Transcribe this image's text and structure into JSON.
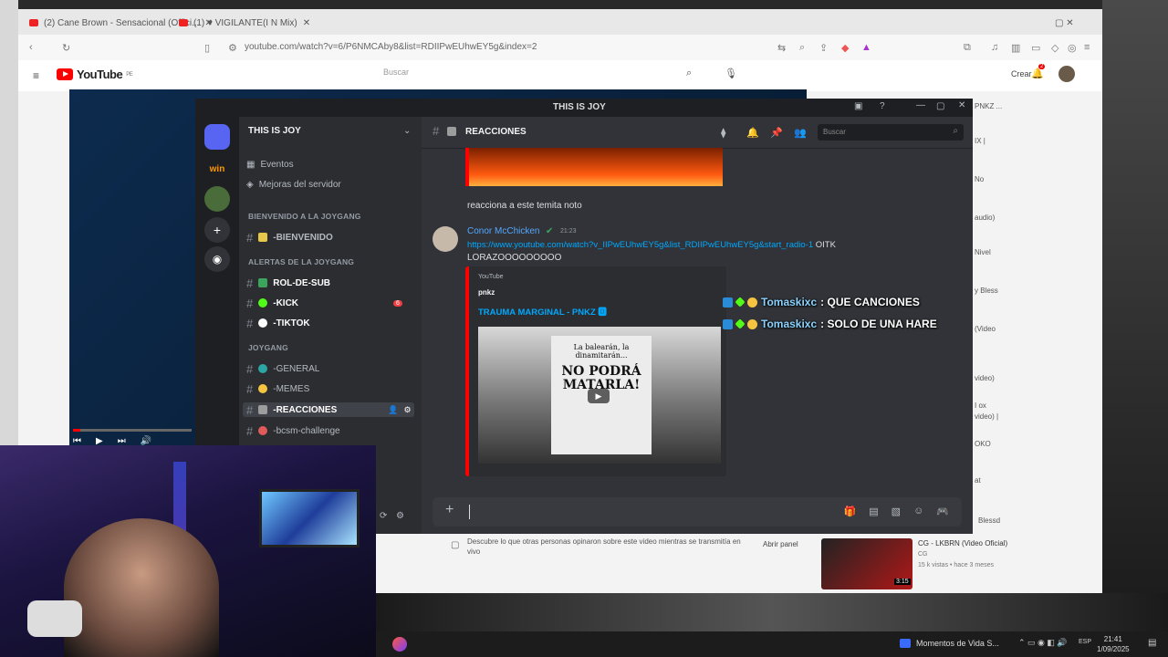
{
  "browser": {
    "tabs": [
      "(2) Cane Brown - Sensacional (Offici...",
      "(1) ♥ VIGILANTE(I N Mix)"
    ],
    "url": "youtube.com/watch?v=6/P6NMCAby8&list=RDIIPwEUhwEY5g&index=2",
    "youtube_label": "YouTube",
    "youtube_country": "PE",
    "search_placeholder": "Buscar",
    "create_label": "Crear",
    "notif_count": "2"
  },
  "youtube": {
    "rail": [
      "PNKZ ...",
      "IX |",
      "No",
      "audio)",
      "Nivel",
      "y Bless",
      "(Video",
      "video)",
      "I ox",
      "video) |",
      "OKO",
      "at",
      "Blessd"
    ],
    "comment_prompt": "Descubre lo que otras personas opinaron sobre este video mientras se transmitía en vivo",
    "open_panel": "Abrir panel",
    "suggestion_title": "CG - LKBRN (Video Oficial)",
    "suggestion_channel": "CG",
    "suggestion_meta": "15 k vistas • hace 3 meses",
    "suggestion_duration": "3:15"
  },
  "discord": {
    "window_title": "THIS IS JOY",
    "server_name": "THIS IS JOY",
    "nav": [
      {
        "label": "Eventos",
        "icon": "calendar-icon"
      },
      {
        "label": "Mejoras del servidor",
        "icon": "boost-icon"
      }
    ],
    "categories": [
      {
        "label": "BIENVENIDO A LA JOYGANG",
        "channels": [
          {
            "label": "-BIENVENIDO",
            "color": "#e6c84a"
          }
        ]
      },
      {
        "label": "ALERTAS DE LA JOYGANG",
        "channels": [
          {
            "label": "ROL-DE-SUB",
            "color": "#3ba55c"
          },
          {
            "label": "-KICK",
            "color": "#53fc18",
            "badge": "6"
          },
          {
            "label": "-TIKTOK",
            "color": "#ffffff"
          }
        ]
      },
      {
        "label": "JOYGANG",
        "channels": [
          {
            "label": "-GENERAL",
            "color": "#2ca5a5"
          },
          {
            "label": "-MEMES",
            "color": "#f5c542"
          },
          {
            "label": "-REACCIONES",
            "color": "#9c9c9c",
            "active": true
          },
          {
            "label": "-bcsm-challenge",
            "color": "#e05a5a"
          }
        ]
      }
    ],
    "channel_header": "REACCIONES",
    "search_placeholder": "Buscar",
    "messages": {
      "text1": "reacciona a este temita noto",
      "author": "Conor McChicken",
      "time": "21:23",
      "link": "https://www.youtube.com/watch?v_IIPwEUhwEY5g&list_RDIIPwEUhwEY5g&start_radio-1",
      "link_suffix": "OITK",
      "text2": "LORAZOOOOOOOOO"
    },
    "embed": {
      "provider": "YouTube",
      "author": "pnkz",
      "title": "TRAUMA MARGINAL - PNKZ 🅳",
      "poster_line1": "La balearán, la dinamitarán...",
      "poster_line2": "NO PODRÁ MATARLA!"
    }
  },
  "overlay_chat": [
    {
      "user": "Tomaskixc",
      "text": ": QUE CANCIONES"
    },
    {
      "user": "Tomaskixc",
      "text": ": SOLO DE UNA HARE"
    }
  ],
  "taskbar": {
    "app": "Momentos de Vida S...",
    "lang": "ESP",
    "time": "21:41",
    "date": "1/09/2025"
  }
}
